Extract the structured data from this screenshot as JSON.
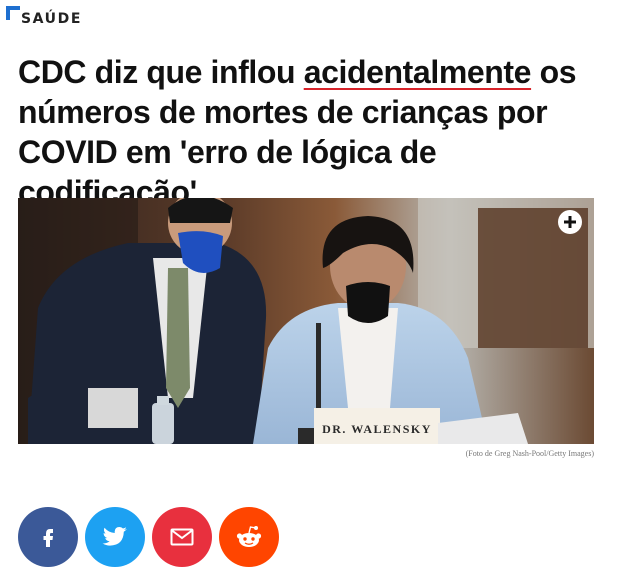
{
  "section": {
    "label": "SAÚDE"
  },
  "article": {
    "headline_part1": "CDC diz que inflou ",
    "headline_highlight": "acidentalmente",
    "headline_part2": " os números de mortes de crianças por COVID em 'erro de lógica de codificação'",
    "photo_placard": "DR. WALENSKY",
    "photo_caption": "(Foto de Greg Nash-Pool/Getty Images)"
  },
  "share": [
    {
      "network": "facebook",
      "icon": "facebook-icon",
      "color": "#3b5998"
    },
    {
      "network": "twitter",
      "icon": "twitter-icon",
      "color": "#1da1f2"
    },
    {
      "network": "email",
      "icon": "mail-icon",
      "color": "#e8303e"
    },
    {
      "network": "reddit",
      "icon": "reddit-icon",
      "color": "#ff4500"
    }
  ],
  "colors": {
    "accent": "#1e6fd0",
    "underline": "#d8232a"
  }
}
